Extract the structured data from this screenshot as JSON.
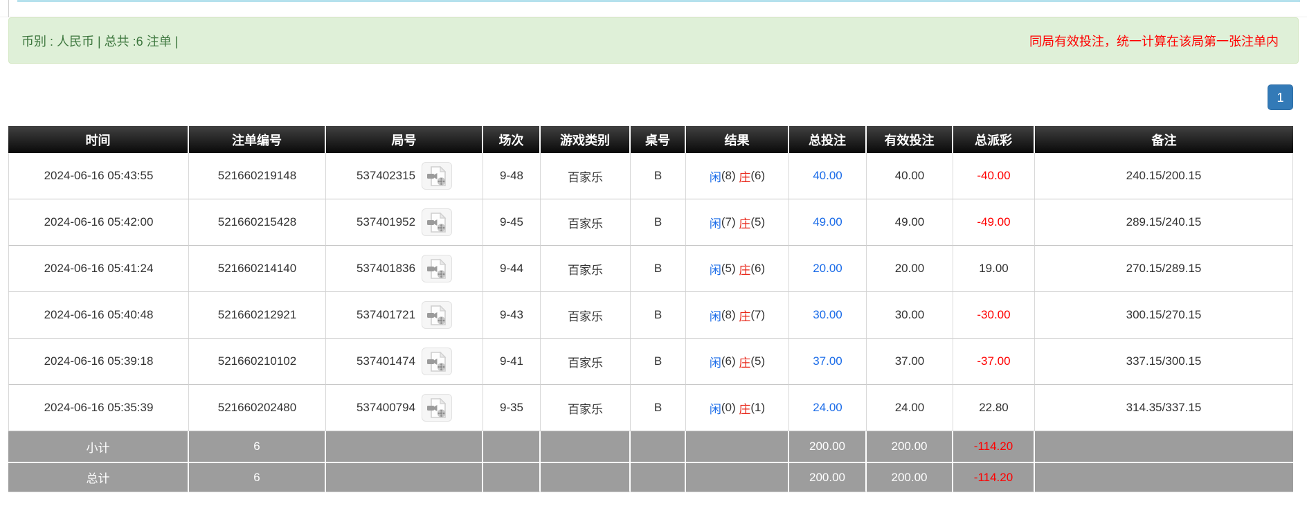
{
  "summary_bar": {
    "left_text": "币别 : 人民币 | 总共 :6 注单 |",
    "right_note": "同局有效投注，统一计算在该局第一张注单内"
  },
  "pagination": {
    "current_page": "1"
  },
  "icons": {
    "round_replay": "video-file-icon"
  },
  "table": {
    "columns": [
      {
        "key": "time",
        "label": "时间"
      },
      {
        "key": "bet-id",
        "label": "注单编号"
      },
      {
        "key": "round-id",
        "label": "局号"
      },
      {
        "key": "session",
        "label": "场次"
      },
      {
        "key": "game-type",
        "label": "游戏类别"
      },
      {
        "key": "table-code",
        "label": "桌号"
      },
      {
        "key": "result",
        "label": "结果"
      },
      {
        "key": "total-bet",
        "label": "总投注"
      },
      {
        "key": "valid-bet",
        "label": "有效投注"
      },
      {
        "key": "payout",
        "label": "总派彩"
      },
      {
        "key": "remark",
        "label": "备注"
      }
    ],
    "rows": [
      {
        "time": "2024-06-16 05:43:55",
        "bet_id": "521660219148",
        "round_id": "537402315",
        "session": "9-48",
        "game_type": "百家乐",
        "table_code": "B",
        "result_player_label": "闲",
        "result_player_score": "(8) ",
        "result_banker_label": "庄",
        "result_banker_score": "(6)",
        "total_bet": "40.00",
        "valid_bet": "40.00",
        "payout": "-40.00",
        "remark": "240.15/200.15"
      },
      {
        "time": "2024-06-16 05:42:00",
        "bet_id": "521660215428",
        "round_id": "537401952",
        "session": "9-45",
        "game_type": "百家乐",
        "table_code": "B",
        "result_player_label": "闲",
        "result_player_score": "(7) ",
        "result_banker_label": "庄",
        "result_banker_score": "(5)",
        "total_bet": "49.00",
        "valid_bet": "49.00",
        "payout": "-49.00",
        "remark": "289.15/240.15"
      },
      {
        "time": "2024-06-16 05:41:24",
        "bet_id": "521660214140",
        "round_id": "537401836",
        "session": "9-44",
        "game_type": "百家乐",
        "table_code": "B",
        "result_player_label": "闲",
        "result_player_score": "(5) ",
        "result_banker_label": "庄",
        "result_banker_score": "(6)",
        "total_bet": "20.00",
        "valid_bet": "20.00",
        "payout": "19.00",
        "remark": "270.15/289.15"
      },
      {
        "time": "2024-06-16 05:40:48",
        "bet_id": "521660212921",
        "round_id": "537401721",
        "session": "9-43",
        "game_type": "百家乐",
        "table_code": "B",
        "result_player_label": "闲",
        "result_player_score": "(8) ",
        "result_banker_label": "庄",
        "result_banker_score": "(7)",
        "total_bet": "30.00",
        "valid_bet": "30.00",
        "payout": "-30.00",
        "remark": "300.15/270.15"
      },
      {
        "time": "2024-06-16 05:39:18",
        "bet_id": "521660210102",
        "round_id": "537401474",
        "session": "9-41",
        "game_type": "百家乐",
        "table_code": "B",
        "result_player_label": "闲",
        "result_player_score": "(6) ",
        "result_banker_label": "庄",
        "result_banker_score": "(5)",
        "total_bet": "37.00",
        "valid_bet": "37.00",
        "payout": "-37.00",
        "remark": "337.15/300.15"
      },
      {
        "time": "2024-06-16 05:35:39",
        "bet_id": "521660202480",
        "round_id": "537400794",
        "session": "9-35",
        "game_type": "百家乐",
        "table_code": "B",
        "result_player_label": "闲",
        "result_player_score": "(0) ",
        "result_banker_label": "庄",
        "result_banker_score": "(1)",
        "total_bet": "24.00",
        "valid_bet": "24.00",
        "payout": "22.80",
        "remark": "314.35/337.15"
      }
    ],
    "footer_rows": [
      {
        "label": "小计",
        "count": "6",
        "total_bet": "200.00",
        "valid_bet": "200.00",
        "payout": "-114.20"
      },
      {
        "label": "总计",
        "count": "6",
        "total_bet": "200.00",
        "valid_bet": "200.00",
        "payout": "-114.20"
      }
    ]
  },
  "colors": {
    "link_blue": "#1b6ce8",
    "banker_red": "#e8291b",
    "negative_red": "#ff0000",
    "summary_green_bg": "#dff0d8",
    "summary_green_text": "#3c763d",
    "note_red": "#ff0000",
    "pagination_blue": "#337ab7",
    "footer_gray": "#9d9d9d"
  }
}
